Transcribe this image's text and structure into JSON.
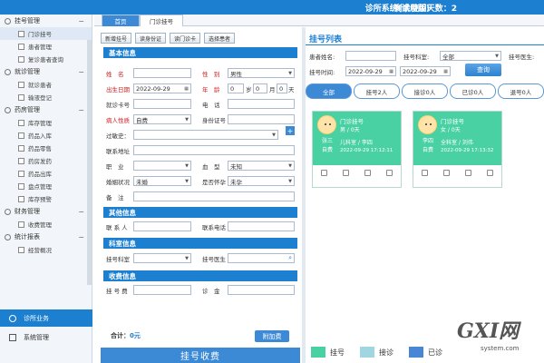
{
  "header": {
    "title": "诊所系统(试用版)",
    "trial": "剩余使用天数：2"
  },
  "tabs": {
    "home": "首页",
    "register": "门诊挂号"
  },
  "sidebar": {
    "groups": [
      {
        "label": "挂号管理",
        "items": [
          "门诊挂号",
          "患者管理",
          "复诊患者查询"
        ]
      },
      {
        "label": "就诊管理",
        "items": [
          "就诊患者",
          "输液登记"
        ]
      },
      {
        "label": "药房管理",
        "items": [
          "库存管理",
          "药品入库",
          "药品零售",
          "药房发药",
          "药品出库",
          "盘点管理",
          "库存预警"
        ]
      },
      {
        "label": "财务管理",
        "items": [
          "收费管理"
        ]
      },
      {
        "label": "统计报表",
        "items": [
          "经营概况"
        ]
      }
    ],
    "bottom": [
      "诊所业务",
      "系统管理"
    ]
  },
  "toolbar": {
    "b1": "新增挂号",
    "b2": "读身份证",
    "b3": "读门诊卡",
    "b4": "选择患者"
  },
  "form": {
    "basic": "基本信息",
    "name": "姓　名",
    "sex": "性　别",
    "sex_val": "男性",
    "dob": "出生日期",
    "dob_val": "2022-09-29",
    "age": "年　龄",
    "age_y": "0",
    "age_m": "0",
    "age_d": "0",
    "u_y": "岁",
    "u_m": "月",
    "u_d": "天",
    "card": "就诊卡号",
    "phone": "电　话",
    "nature": "病人性质",
    "nature_val": "自费",
    "id": "身份证号",
    "allergy": "过敏史：",
    "addr": "联系地址",
    "job": "职　业",
    "blood": "血　型",
    "blood_val": "未知",
    "marital": "婚姻状况",
    "marital_val": "未婚",
    "preg": "是否怀孕",
    "preg_val": "未孕",
    "note": "备　注",
    "other": "其他信息",
    "contact": "联 系 人",
    "contact_phone": "联系电话",
    "dept_sec": "科室信息",
    "dept": "挂号科室",
    "doctor": "挂号医生",
    "fee_sec": "收费信息",
    "fee": "挂 号 费",
    "consult": "诊　金",
    "plus": "+",
    "sum_label": "合计：",
    "sum_val": "0元",
    "addfee": "附加费",
    "feebtn": "挂号收费"
  },
  "list": {
    "title": "挂号列表",
    "patient": "患者姓名:",
    "dept": "挂号科室:",
    "dept_val": "全部",
    "doctor": "挂号医生:",
    "time": "挂号时间:",
    "date1": "2022-09-29",
    "date2": "2022-09-29",
    "query": "查询",
    "statuses": [
      "全部",
      "挂号2人",
      "接诊0人",
      "已诊0人",
      "退号0人"
    ],
    "cards": [
      {
        "name": "张三",
        "type": "自费",
        "l1": "门诊挂号",
        "l2": "男 / 0天",
        "l3": "儿科室 / 李四",
        "l4": "2022-09-29 17:12:11"
      },
      {
        "name": "李四",
        "type": "自费",
        "l1": "门诊挂号",
        "l2": "女 / 0天",
        "l3": "全科室 / 刘伟",
        "l4": "2022-09-29 17:13:32"
      }
    ],
    "legend": [
      {
        "label": "挂号",
        "color": "#49d1a3"
      },
      {
        "label": "接诊",
        "color": "#9fd6e2"
      },
      {
        "label": "已诊",
        "color": "#4a86d6"
      }
    ]
  },
  "colors": {
    "accent": "#1c7fd0",
    "card": "#49d1a3"
  },
  "watermark": {
    "text": "GXI网",
    "sub": "system.com"
  }
}
